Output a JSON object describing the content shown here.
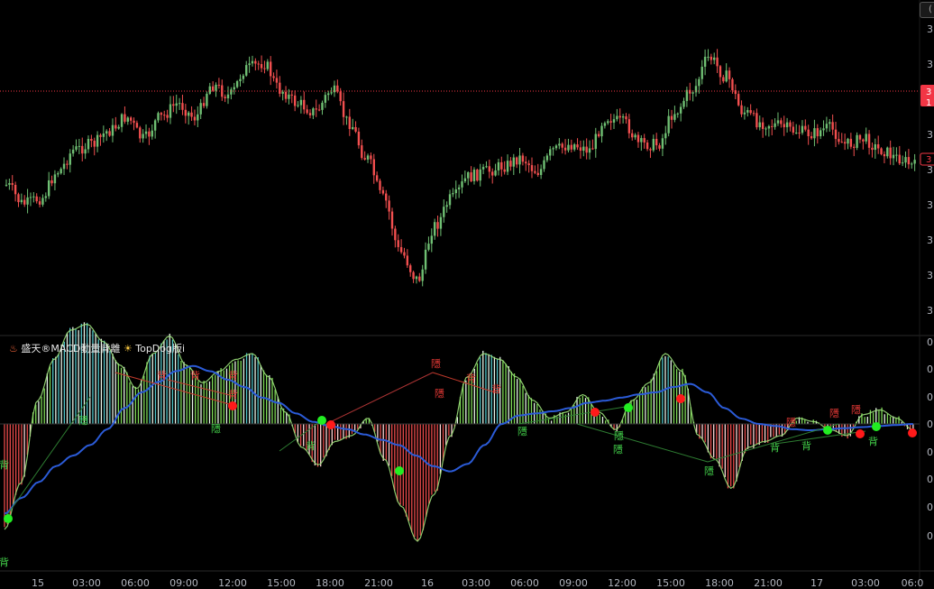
{
  "indicator": {
    "icon": "fire-icon",
    "name": "盛天®MACD動量背離",
    "badge_icon": "sun-icon",
    "edition": "TopDog版i"
  },
  "toolbar": {
    "corner_label": "("
  },
  "price_axis": {
    "labels": [
      "3",
      "3",
      "3",
      "3",
      "3",
      "3",
      "3",
      "3",
      "3"
    ],
    "current_price_tag": [
      "3",
      "1"
    ],
    "secondary_tag": "3"
  },
  "indicator_axis": {
    "labels": [
      "0",
      "0",
      "0",
      "0",
      "0",
      "0",
      "0",
      "0"
    ]
  },
  "time_axis": {
    "labels": [
      "15",
      "03:00",
      "06:00",
      "09:00",
      "12:00",
      "15:00",
      "18:00",
      "21:00",
      "16",
      "03:00",
      "06:00",
      "09:00",
      "12:00",
      "15:00",
      "18:00",
      "21:00",
      "17",
      "03:00",
      "06:0"
    ]
  },
  "signals": {
    "bull_text": "背",
    "hidden_text": "隱"
  },
  "colors": {
    "background": "#000000",
    "up_candle": "#6fbf73",
    "down_candle": "#f24f4f",
    "hist_pos": "#7ed957",
    "hist_pos_light": "#e8f5e9",
    "hist_top_cyan": "#4fc3c7",
    "hist_neg": "#e84a4a",
    "hist_neg_light": "#ffd6d6",
    "signal_line": "#2b5bd7",
    "bull_dot": "#22ee22",
    "bear_dot": "#ff1a1a",
    "price_line": "#f23645"
  },
  "chart_data": [
    {
      "type": "candlestick",
      "title": "",
      "x_ticks": [
        "15",
        "03:00",
        "06:00",
        "09:00",
        "12:00",
        "15:00",
        "18:00",
        "21:00",
        "16",
        "03:00",
        "06:00",
        "09:00",
        "12:00",
        "15:00",
        "18:00",
        "21:00",
        "17",
        "03:00",
        "06:0"
      ],
      "close_path_shape": [
        0.55,
        0.62,
        0.6,
        0.5,
        0.42,
        0.4,
        0.35,
        0.3,
        0.38,
        0.3,
        0.25,
        0.3,
        0.18,
        0.22,
        0.12,
        0.1,
        0.2,
        0.25,
        0.28,
        0.2,
        0.32,
        0.45,
        0.6,
        0.8,
        0.9,
        0.7,
        0.6,
        0.52,
        0.5,
        0.48,
        0.45,
        0.5,
        0.42,
        0.4,
        0.42,
        0.3,
        0.32,
        0.4,
        0.4,
        0.28,
        0.2,
        0.08,
        0.15,
        0.28,
        0.32,
        0.33,
        0.35,
        0.36,
        0.34,
        0.4,
        0.38,
        0.42,
        0.45,
        0.48
      ]
    },
    {
      "type": "bar",
      "title": "",
      "histogram_shape": [
        -0.9,
        -0.5,
        0.2,
        0.55,
        0.8,
        0.85,
        0.7,
        0.5,
        0.3,
        0.6,
        0.75,
        0.5,
        0.35,
        0.45,
        0.55,
        0.6,
        0.4,
        0.1,
        -0.2,
        -0.35,
        -0.15,
        -0.1,
        0.05,
        -0.3,
        -0.7,
        -1.0,
        -0.6,
        -0.1,
        0.4,
        0.6,
        0.55,
        0.4,
        0.2,
        0.05,
        0.1,
        0.25,
        0.1,
        -0.05,
        0.2,
        0.35,
        0.6,
        0.45,
        -0.1,
        -0.3,
        -0.55,
        -0.2,
        -0.15,
        -0.1,
        0.05,
        0.02,
        -0.05,
        -0.1,
        0.08,
        0.12,
        0.05,
        -0.05
      ],
      "signal_line_shape": [
        -0.85,
        -0.7,
        -0.55,
        -0.4,
        -0.3,
        -0.2,
        -0.05,
        0.15,
        0.3,
        0.4,
        0.5,
        0.55,
        0.5,
        0.42,
        0.35,
        0.25,
        0.2,
        0.1,
        0.02,
        -0.02,
        -0.05,
        -0.1,
        -0.15,
        -0.2,
        -0.3,
        -0.4,
        -0.45,
        -0.38,
        -0.2,
        0.0,
        0.08,
        0.1,
        0.12,
        0.15,
        0.2,
        0.22,
        0.25,
        0.28,
        0.3,
        0.35,
        0.38,
        0.3,
        0.15,
        0.05,
        0.0,
        -0.02,
        -0.05,
        -0.06,
        -0.05,
        -0.04,
        -0.03,
        -0.02,
        -0.01,
        0.0
      ]
    }
  ]
}
